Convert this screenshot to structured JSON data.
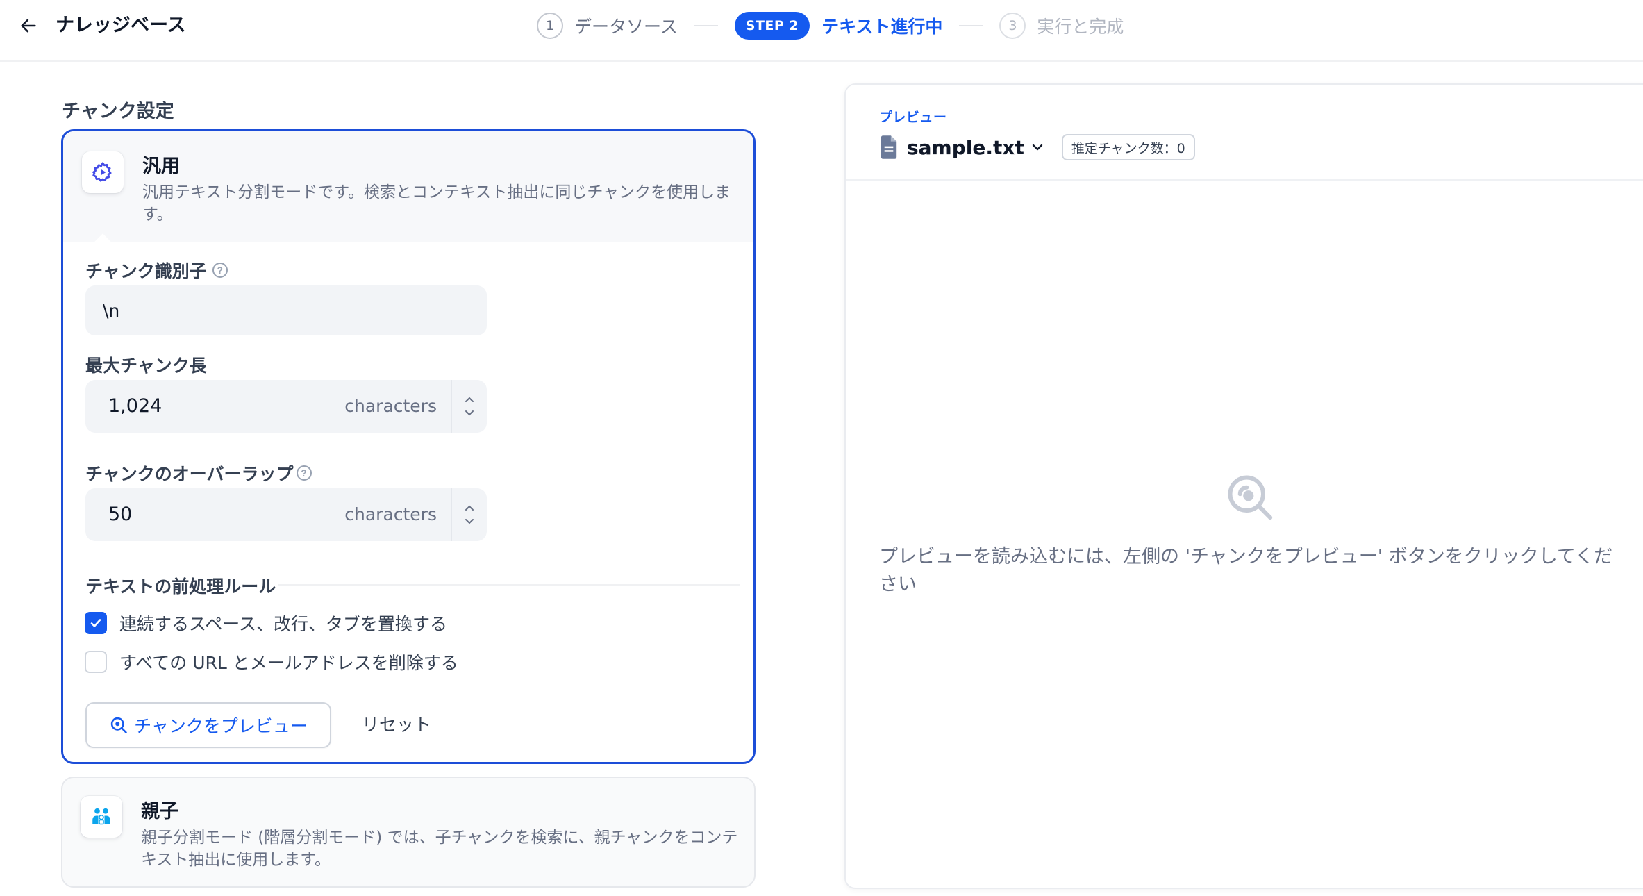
{
  "header": {
    "title": "ナレッジベース",
    "steps": [
      {
        "number": "1",
        "label": "データソース"
      },
      {
        "badge": "STEP 2",
        "label": "テキスト進行中"
      },
      {
        "number": "3",
        "label": "実行と完成"
      }
    ]
  },
  "chunk_settings": {
    "section_title": "チャンク設定",
    "general": {
      "name": "汎用",
      "description": "汎用テキスト分割モードです。検索とコンテキスト抽出に同じチャンクを使用します。",
      "icon": "gear-icon",
      "delimiter": {
        "label": "チャンク識別子",
        "value": "\\n"
      },
      "max_length": {
        "label": "最大チャンク長",
        "value": "1,024",
        "unit": "characters"
      },
      "overlap": {
        "label": "チャンクのオーバーラップ",
        "value": "50",
        "unit": "characters"
      },
      "rules": {
        "title": "テキストの前処理ルール",
        "items": [
          {
            "label": "連続するスペース、改行、タブを置換する",
            "checked": true
          },
          {
            "label": "すべての URL とメールアドレスを削除する",
            "checked": false
          }
        ]
      },
      "preview_button": "チャンクをプレビュー",
      "reset_button": "リセット"
    },
    "parent_child": {
      "name": "親子",
      "description": "親子分割モード (階層分割モード) では、子チャンクを検索に、親チャンクをコンテキスト抽出に使用します。",
      "icon": "parent-child-icon"
    }
  },
  "preview": {
    "label": "プレビュー",
    "file_name": "sample.txt",
    "estimated_chunks": "推定チャンク数：0",
    "empty_message": "プレビューを読み込むには、左側の 'チャンクをプレビュー' ボタンをクリックしてください",
    "empty_icon": "search-icon"
  },
  "colors": {
    "accent": "#155aef",
    "selected_border": "#1d4ed8",
    "muted_text": "#676f83"
  }
}
